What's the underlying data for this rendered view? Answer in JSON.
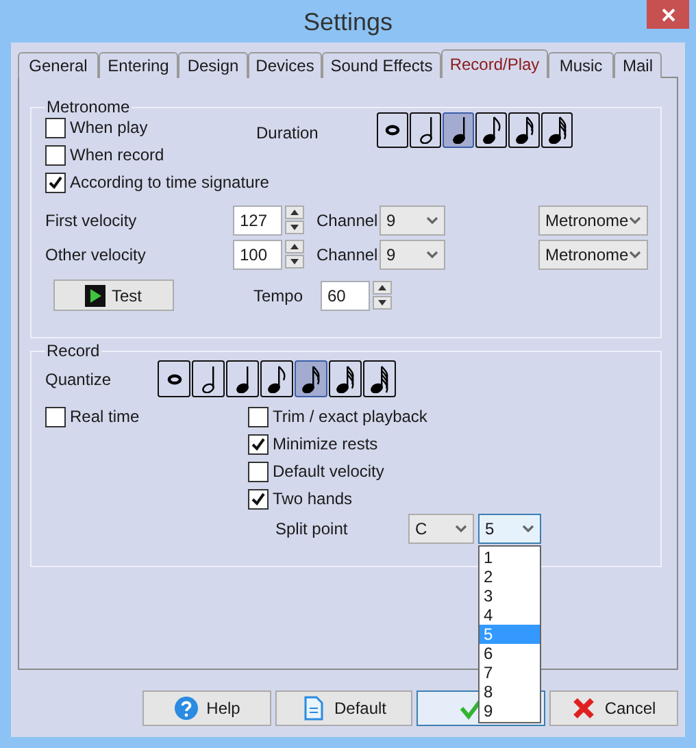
{
  "window": {
    "title": "Settings"
  },
  "tabs": [
    {
      "label": "General",
      "selected": false
    },
    {
      "label": "Entering",
      "selected": false
    },
    {
      "label": "Design",
      "selected": false
    },
    {
      "label": "Devices",
      "selected": false
    },
    {
      "label": "Sound Effects",
      "selected": false
    },
    {
      "label": "Record/Play",
      "selected": true
    },
    {
      "label": "Music",
      "selected": false
    },
    {
      "label": "Mail",
      "selected": false
    }
  ],
  "metronome": {
    "title": "Metronome",
    "checkboxes": [
      {
        "label": "When play",
        "checked": false
      },
      {
        "label": "When record",
        "checked": false
      },
      {
        "label": "According to time signature",
        "checked": true
      }
    ],
    "duration": {
      "label": "Duration",
      "notes": [
        {
          "kind": "whole",
          "selected": false
        },
        {
          "kind": "half",
          "selected": false
        },
        {
          "kind": "quarter",
          "selected": true
        },
        {
          "kind": "eighth",
          "selected": false
        },
        {
          "kind": "sixteenth",
          "selected": false
        },
        {
          "kind": "thirty_second",
          "selected": false
        }
      ]
    },
    "velocities": [
      {
        "label": "First velocity",
        "value": "127",
        "channel_label": "Channel",
        "channel": "9",
        "sound": "Metronome"
      },
      {
        "label": "Other velocity",
        "value": "100",
        "channel_label": "Channel",
        "channel": "9",
        "sound": "Metronome"
      }
    ],
    "test_button": "Test",
    "tempo": {
      "label": "Tempo",
      "value": "60"
    }
  },
  "record": {
    "title": "Record",
    "quantize": {
      "label": "Quantize",
      "notes": [
        {
          "kind": "whole",
          "selected": false
        },
        {
          "kind": "half",
          "selected": false
        },
        {
          "kind": "quarter",
          "selected": false
        },
        {
          "kind": "eighth",
          "selected": false
        },
        {
          "kind": "sixteenth",
          "selected": true
        },
        {
          "kind": "thirty_second",
          "selected": false
        },
        {
          "kind": "sixty_fourth",
          "selected": false
        }
      ]
    },
    "real_time": {
      "label": "Real time",
      "checked": false
    },
    "options": [
      {
        "label": "Trim / exact playback",
        "checked": false
      },
      {
        "label": "Minimize rests",
        "checked": true
      },
      {
        "label": "Default velocity",
        "checked": false
      },
      {
        "label": "Two hands",
        "checked": true
      }
    ],
    "split_point": {
      "label": "Split point",
      "note": "C",
      "octave": "5",
      "octave_list": [
        {
          "label": "1",
          "selected": false
        },
        {
          "label": "2",
          "selected": false
        },
        {
          "label": "3",
          "selected": false
        },
        {
          "label": "4",
          "selected": false
        },
        {
          "label": "5",
          "selected": true
        },
        {
          "label": "6",
          "selected": false
        },
        {
          "label": "7",
          "selected": false
        },
        {
          "label": "8",
          "selected": false
        },
        {
          "label": "9",
          "selected": false
        }
      ]
    }
  },
  "buttons": [
    {
      "kind": "help",
      "label": "Help"
    },
    {
      "kind": "default",
      "label": "Default"
    },
    {
      "kind": "ok"
    },
    {
      "kind": "cancel",
      "label": "Cancel"
    }
  ]
}
